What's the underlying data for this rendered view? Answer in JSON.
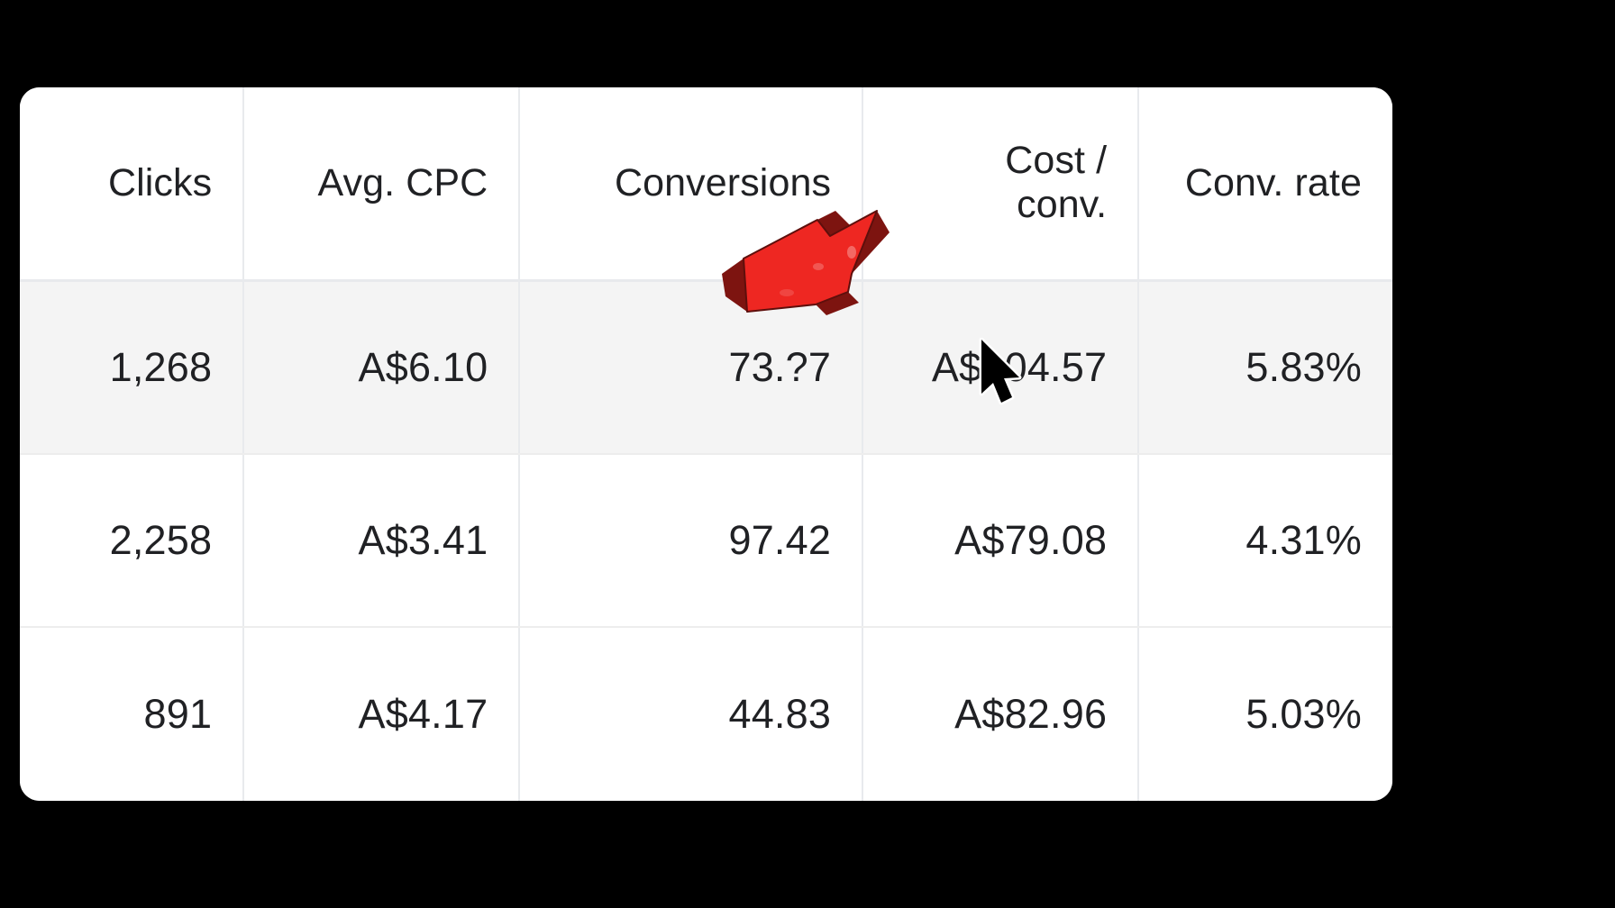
{
  "table": {
    "columns": [
      {
        "id": "clicks",
        "label": "Clicks",
        "lines": [
          "Clicks"
        ]
      },
      {
        "id": "avg_cpc",
        "label": "Avg. CPC",
        "lines": [
          "Avg. CPC"
        ]
      },
      {
        "id": "conversions",
        "label": "Conversions",
        "lines": [
          "Conversions"
        ]
      },
      {
        "id": "cost_conv",
        "label": "Cost / conv.",
        "lines": [
          "Cost /",
          "conv."
        ]
      },
      {
        "id": "conv_rate",
        "label": "Conv. rate",
        "lines": [
          "Conv. rate"
        ]
      }
    ],
    "rows": [
      {
        "highlighted": true,
        "clicks": "1,268",
        "avg_cpc": "A$6.10",
        "conversions": "73.?7",
        "cost_conv": "A$104.57",
        "conv_rate": "5.83%"
      },
      {
        "highlighted": false,
        "clicks": "2,258",
        "avg_cpc": "A$3.41",
        "conversions": "97.42",
        "cost_conv": "A$79.08",
        "conv_rate": "4.31%"
      },
      {
        "highlighted": false,
        "clicks": "891",
        "avg_cpc": "A$4.17",
        "conversions": "44.83",
        "cost_conv": "A$82.96",
        "conv_rate": "5.03%"
      }
    ]
  },
  "overlays": {
    "arrow": {
      "name": "red-arrow-annotation",
      "direction": "up-right",
      "fill_color": "#ee2722",
      "shadow_color": "#8f1713",
      "edge_color": "#7d1410"
    },
    "cursor": {
      "name": "mouse-cursor",
      "fill_color": "#000000",
      "outline_color": "#ffffff"
    }
  },
  "theme": {
    "page_background": "#000000",
    "card_background": "#ffffff",
    "row_highlight": "#f4f4f4",
    "grid_line": "#e8eaed",
    "text_color": "#202124"
  }
}
